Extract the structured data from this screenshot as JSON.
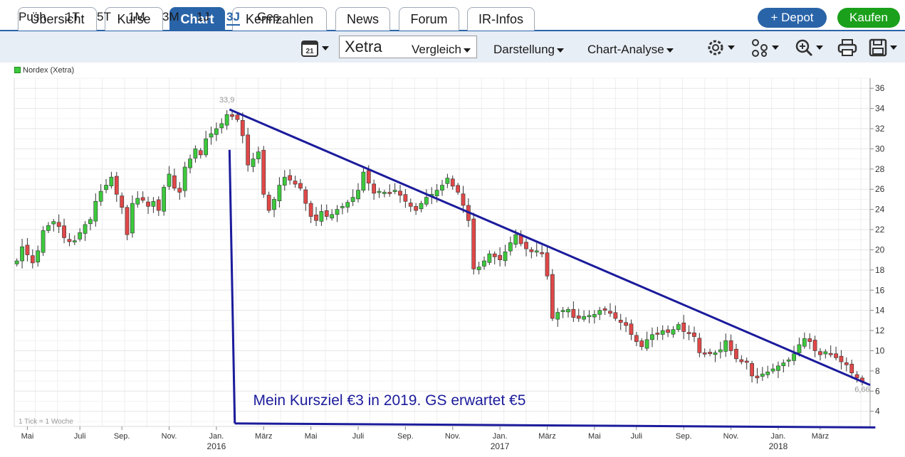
{
  "tabs": [
    {
      "label": "Übersicht",
      "active": false
    },
    {
      "label": "Kurse",
      "active": false
    },
    {
      "label": "Chart",
      "active": true
    },
    {
      "label": "Kennzahlen",
      "active": false
    },
    {
      "label": "News",
      "active": false
    },
    {
      "label": "Forum",
      "active": false
    },
    {
      "label": "IR-Infos",
      "active": false
    }
  ],
  "actions": {
    "depot": "+ Depot",
    "kaufen": "Kaufen"
  },
  "toolbar": {
    "ranges": [
      "Push",
      "1T",
      "5T",
      "1M",
      "3M",
      "1J",
      "3J",
      "Ges."
    ],
    "selected_range": "3J",
    "calendar_day": "21",
    "exchange": "Xetra",
    "menus": {
      "vergleich": "Vergleich",
      "darstellung": "Darstellung",
      "analyse": "Chart-Analyse"
    }
  },
  "colors": {
    "accent": "#2a64a8",
    "up": "#3cc93c",
    "down": "#e04848",
    "trendline": "#1b1b9c",
    "depot": "#2a64a8",
    "kaufen": "#1aa01a"
  },
  "chart_data": {
    "type": "candlestick",
    "legend": "Nordex (Xetra)",
    "tick_note": "1 Tick = 1 Woche",
    "ylim": [
      2.5,
      37
    ],
    "yticks": [
      4,
      6,
      8,
      10,
      12,
      14,
      16,
      18,
      20,
      22,
      24,
      26,
      28,
      30,
      32,
      34,
      36
    ],
    "xticks": [
      {
        "label": "Mai",
        "week": 2
      },
      {
        "label": "Juli",
        "week": 12
      },
      {
        "label": "Sep.",
        "week": 20
      },
      {
        "label": "Nov.",
        "week": 29
      },
      {
        "label": "Jan.",
        "week": 38,
        "year": "2016"
      },
      {
        "label": "März",
        "week": 47
      },
      {
        "label": "Mai",
        "week": 56
      },
      {
        "label": "Juli",
        "week": 65
      },
      {
        "label": "Sep.",
        "week": 74
      },
      {
        "label": "Nov.",
        "week": 83
      },
      {
        "label": "Jan.",
        "week": 92,
        "year": "2017"
      },
      {
        "label": "März",
        "week": 101
      },
      {
        "label": "Mai",
        "week": 110
      },
      {
        "label": "Juli",
        "week": 118
      },
      {
        "label": "Sep.",
        "week": 127
      },
      {
        "label": "Nov.",
        "week": 136
      },
      {
        "label": "Jan.",
        "week": 145,
        "year": "2018"
      },
      {
        "label": "März",
        "week": 153
      }
    ],
    "weeks": 163,
    "closes": [
      18.9,
      20.3,
      19.5,
      18.7,
      19.9,
      21.9,
      22.4,
      22.8,
      22.3,
      21.2,
      20.8,
      20.9,
      21.7,
      22.5,
      23.0,
      24.8,
      25.8,
      26.4,
      27.2,
      25.5,
      24.2,
      21.5,
      24.6,
      25.1,
      24.9,
      24.3,
      24.8,
      23.9,
      26.2,
      27.5,
      26.1,
      25.7,
      28.2,
      29.0,
      30.0,
      29.4,
      31.0,
      31.5,
      32.0,
      32.5,
      33.4,
      33.2,
      32.9,
      31.3,
      28.4,
      29.0,
      29.7,
      25.5,
      23.9,
      25.0,
      26.4,
      27.2,
      26.9,
      26.5,
      26.1,
      24.6,
      23.3,
      22.9,
      23.8,
      23.3,
      23.5,
      24.0,
      24.3,
      24.7,
      25.2,
      25.9,
      27.7,
      26.6,
      25.6,
      25.8,
      25.7,
      25.6,
      25.9,
      25.4,
      24.8,
      24.3,
      23.9,
      24.6,
      25.2,
      25.5,
      25.9,
      26.4,
      27.1,
      26.3,
      25.7,
      24.4,
      22.9,
      18.1,
      18.3,
      18.9,
      19.6,
      19.3,
      19.0,
      19.8,
      20.7,
      21.5,
      20.6,
      20.1,
      19.8,
      19.9,
      19.7,
      17.4,
      13.2,
      13.8,
      14.0,
      14.1,
      13.3,
      13.2,
      13.4,
      13.5,
      13.6,
      14.0,
      14.0,
      13.7,
      13.2,
      12.8,
      12.5,
      11.6,
      10.9,
      10.4,
      11.1,
      11.6,
      11.7,
      12.0,
      11.8,
      12.1,
      12.6,
      11.9,
      11.7,
      11.4,
      9.8,
      9.7,
      9.7,
      9.8,
      10.1,
      11.0,
      10.0,
      9.2,
      8.9,
      8.9,
      7.5,
      7.3,
      7.7,
      7.9,
      8.2,
      8.5,
      8.8,
      9.1,
      9.7,
      10.6,
      11.2,
      10.9,
      10.0,
      9.6,
      9.9,
      9.7,
      9.3,
      8.9,
      8.6,
      7.8,
      7.3,
      6.9
    ],
    "annotations": [
      {
        "type": "label",
        "text": "33,9",
        "week": 40,
        "value": 34.6
      },
      {
        "type": "label",
        "text": "6,66",
        "week": 161,
        "value": 5.9
      },
      {
        "type": "label",
        "text": "Mein Kursziel €3 in 2019. GS erwartet €5",
        "week": 45,
        "value": 4.6
      },
      {
        "type": "trendline",
        "from": {
          "week": 40.5,
          "value": 33.9
        },
        "to": {
          "week": 162.5,
          "value": 6.6
        }
      },
      {
        "type": "line",
        "from": {
          "week": 40.5,
          "value": 29.9
        },
        "to": {
          "week": 41.5,
          "value": 2.8
        }
      },
      {
        "type": "line",
        "from": {
          "week": 41.5,
          "value": 2.8
        },
        "to": {
          "week": 163.5,
          "value": 2.4
        }
      }
    ]
  }
}
